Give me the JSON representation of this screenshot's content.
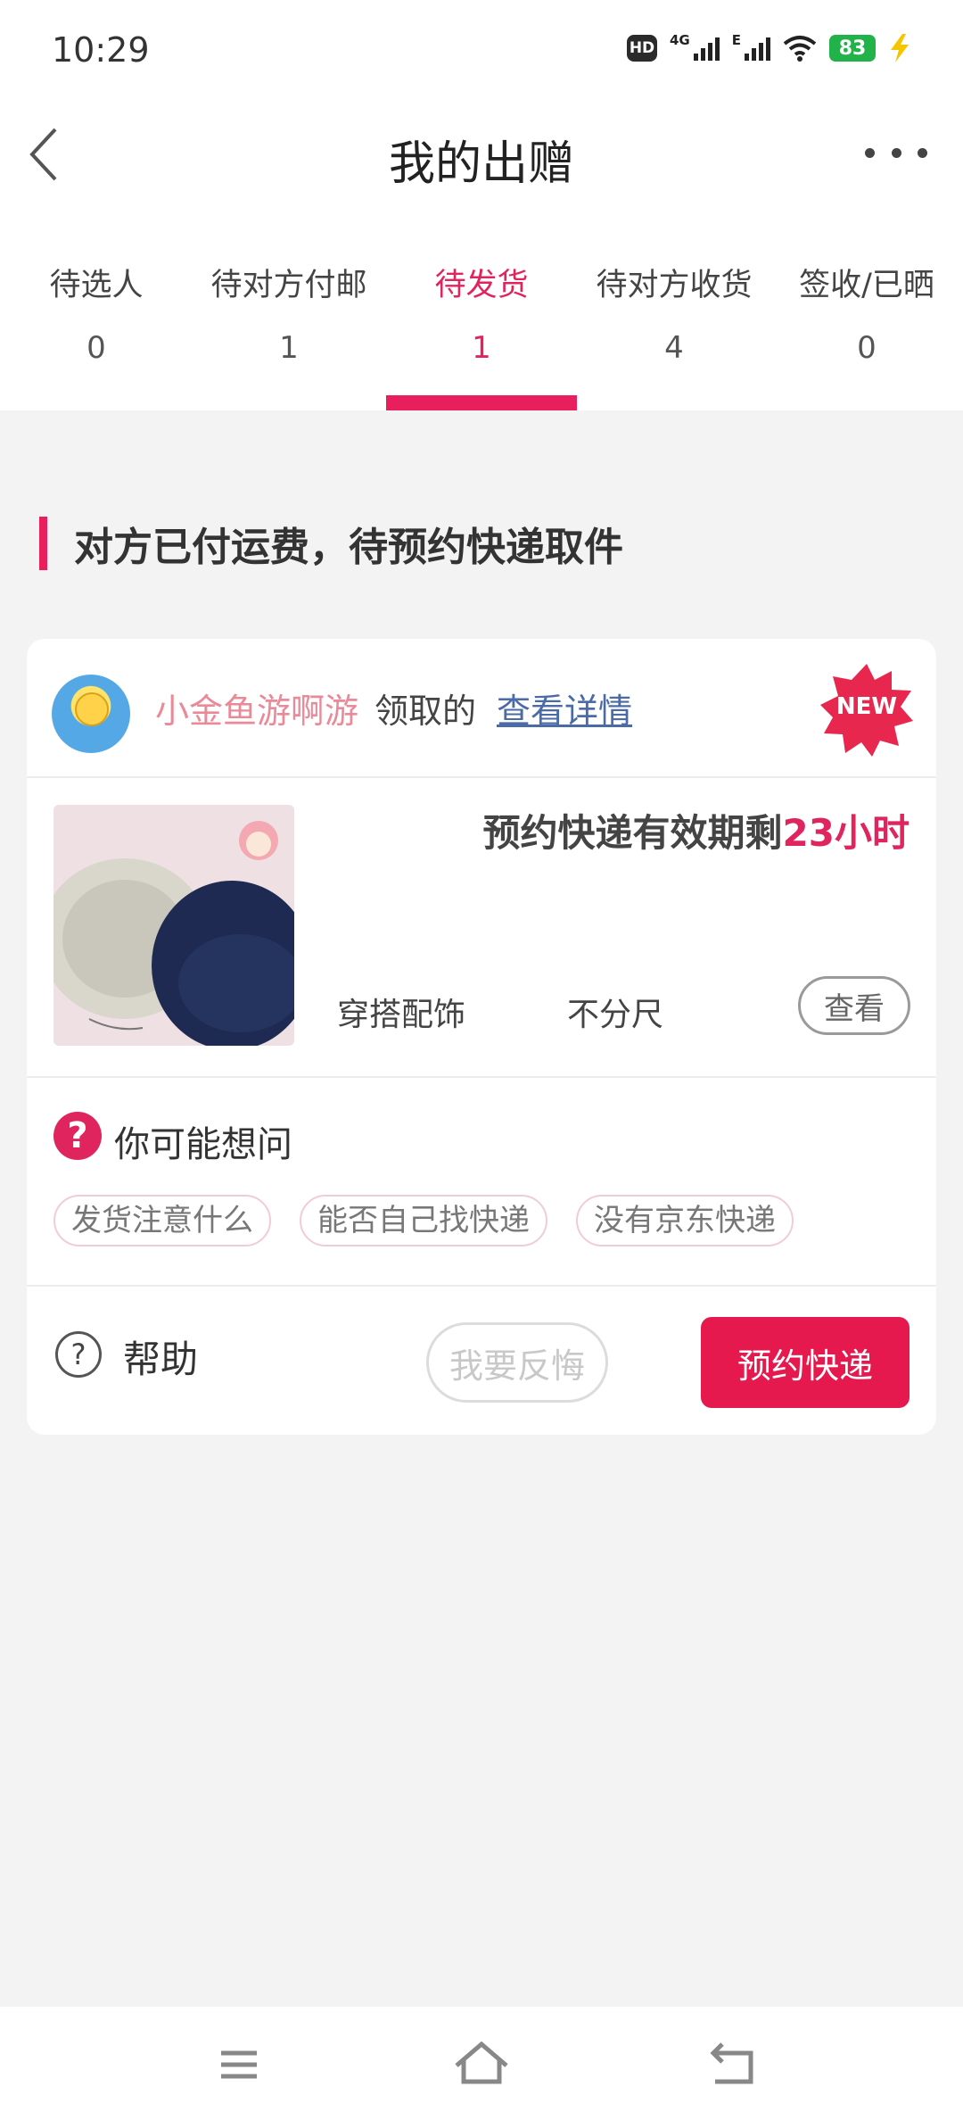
{
  "status_bar": {
    "time": "10:29",
    "hd_label": "HD",
    "net1_label": "4G",
    "net2_label": "E",
    "battery_level": "83",
    "battery_color": "#21b24a"
  },
  "header": {
    "title": "我的出赠"
  },
  "tabs": [
    {
      "label": "待选人",
      "count": "0"
    },
    {
      "label": "待对方付邮",
      "count": "1"
    },
    {
      "label": "待发货",
      "count": "1",
      "active": true
    },
    {
      "label": "待对方收货",
      "count": "4"
    },
    {
      "label": "签收/已晒",
      "count": "0"
    }
  ],
  "section": {
    "heading": "对方已付运费，待预约快递取件"
  },
  "card": {
    "receiver_name": "小金鱼游啊游",
    "received_text": "领取的",
    "detail_link": "查看详情",
    "badge": "NEW",
    "deadline_prefix": "预约快递有效期剩",
    "deadline_value": "23小时",
    "category": "穿搭配饰",
    "size": "不分尺",
    "view_button": "查看",
    "faq_title": "你可能想问",
    "faq_chips": [
      "发货注意什么",
      "能否自己找快递",
      "没有京东快递"
    ],
    "help_label": "帮助",
    "regret_button": "我要反悔",
    "book_button": "预约快递"
  },
  "colors": {
    "accent": "#e91e5c",
    "receiver_name": "#ea8a98",
    "link": "#4b6aa8",
    "page_bg": "#f3f3f4"
  }
}
